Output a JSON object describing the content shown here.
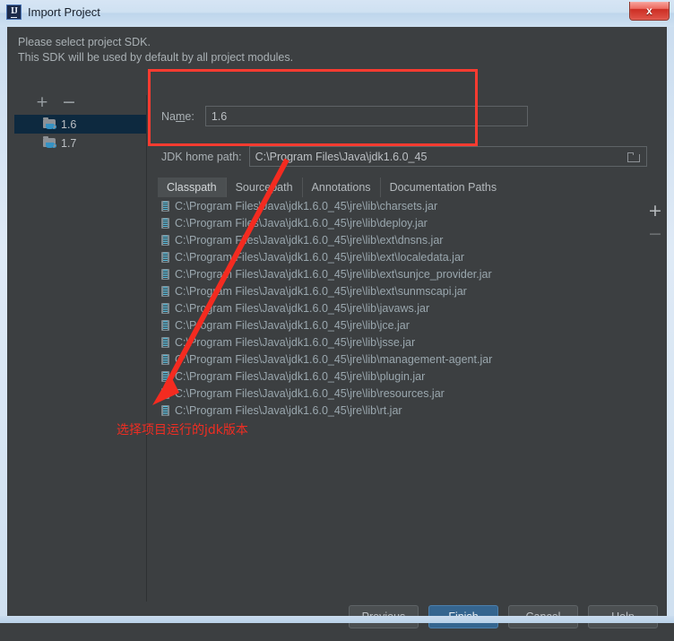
{
  "window": {
    "title": "Import Project",
    "app_icon": "intellij-idea-icon",
    "close_label": "x"
  },
  "hint": {
    "line1": "Please select project SDK.",
    "line2": "This SDK will be used by default by all project modules."
  },
  "tree_toolbar": {
    "add": "+",
    "remove": "−"
  },
  "sdk_tree": {
    "items": [
      {
        "label": "1.6",
        "selected": true
      },
      {
        "label": "1.7",
        "selected": false
      }
    ]
  },
  "form": {
    "name_label_pre": "Na",
    "name_label_mnemonic": "m",
    "name_label_post": "e:",
    "name_value": "1.6",
    "path_label": "JDK home path:",
    "path_value": "C:\\Program Files\\Java\\jdk1.6.0_45",
    "browse_icon": "folder-browse-icon"
  },
  "tabs": [
    {
      "label": "Classpath",
      "active": true
    },
    {
      "label": "Sourcepath",
      "active": false
    },
    {
      "label": "Annotations",
      "active": false
    },
    {
      "label": "Documentation Paths",
      "active": false
    }
  ],
  "classpath_list": [
    "C:\\Program Files\\Java\\jdk1.6.0_45\\jre\\lib\\charsets.jar",
    "C:\\Program Files\\Java\\jdk1.6.0_45\\jre\\lib\\deploy.jar",
    "C:\\Program Files\\Java\\jdk1.6.0_45\\jre\\lib\\ext\\dnsns.jar",
    "C:\\Program Files\\Java\\jdk1.6.0_45\\jre\\lib\\ext\\localedata.jar",
    "C:\\Program Files\\Java\\jdk1.6.0_45\\jre\\lib\\ext\\sunjce_provider.jar",
    "C:\\Program Files\\Java\\jdk1.6.0_45\\jre\\lib\\ext\\sunmscapi.jar",
    "C:\\Program Files\\Java\\jdk1.6.0_45\\jre\\lib\\javaws.jar",
    "C:\\Program Files\\Java\\jdk1.6.0_45\\jre\\lib\\jce.jar",
    "C:\\Program Files\\Java\\jdk1.6.0_45\\jre\\lib\\jsse.jar",
    "C:\\Program Files\\Java\\jdk1.6.0_45\\jre\\lib\\management-agent.jar",
    "C:\\Program Files\\Java\\jdk1.6.0_45\\jre\\lib\\plugin.jar",
    "C:\\Program Files\\Java\\jdk1.6.0_45\\jre\\lib\\resources.jar",
    "C:\\Program Files\\Java\\jdk1.6.0_45\\jre\\lib\\rt.jar"
  ],
  "list_toolbar": {
    "add": "+",
    "remove": "−"
  },
  "footer": {
    "previous_pre": "",
    "previous_mnemonic": "P",
    "previous_post": "revious",
    "finish_mnemonic": "F",
    "finish_post": "inish",
    "cancel": "Cancel",
    "help": "Help"
  },
  "annotation": {
    "note_text": "选择项目运行的jdk版本",
    "highlight_color": "#fb3b30",
    "arrow_color": "#f42b20"
  }
}
